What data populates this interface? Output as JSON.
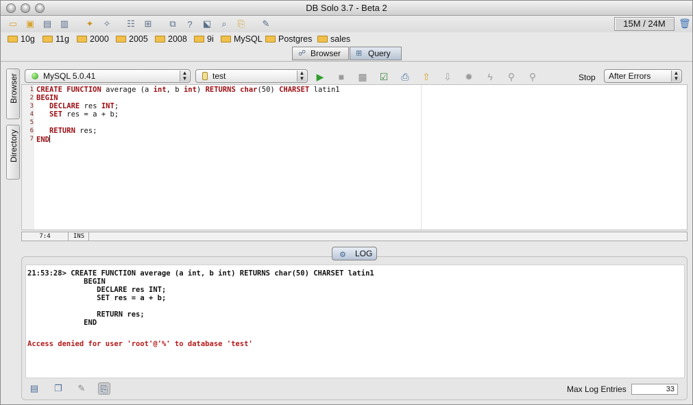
{
  "window": {
    "title": "DB Solo  3.7 - Beta 2"
  },
  "memory": {
    "label": "15M / 24M"
  },
  "bookmarks": [
    "10g",
    "11g",
    "2000",
    "2005",
    "2008",
    "9i",
    "MySQL",
    "Postgres",
    "sales"
  ],
  "tabs": {
    "browser": "Browser",
    "query": "Query"
  },
  "sidebar": {
    "browser": "Browser",
    "directory": "Directory"
  },
  "query_bar": {
    "server": "MySQL 5.0.41",
    "database": "test",
    "stop_label": "Stop",
    "stop_mode": "After Errors"
  },
  "editor": {
    "lines": [
      {
        "n": "1",
        "parts": [
          [
            "kw",
            "CREATE FUNCTION"
          ],
          [
            "t",
            " average (a "
          ],
          [
            "kw",
            "int"
          ],
          [
            "t",
            ", b "
          ],
          [
            "kw",
            "int"
          ],
          [
            "t",
            ") "
          ],
          [
            "kw",
            "RETURNS"
          ],
          [
            "t",
            " "
          ],
          [
            "kw",
            "char"
          ],
          [
            "t",
            "(50) "
          ],
          [
            "kw",
            "CHARSET"
          ],
          [
            "t",
            " latin1"
          ]
        ]
      },
      {
        "n": "2",
        "parts": [
          [
            "kw",
            "BEGIN"
          ]
        ]
      },
      {
        "n": "3",
        "parts": [
          [
            "t",
            "   "
          ],
          [
            "kw",
            "DECLARE"
          ],
          [
            "t",
            " res "
          ],
          [
            "kw",
            "INT"
          ],
          [
            "t",
            ";"
          ]
        ]
      },
      {
        "n": "4",
        "parts": [
          [
            "t",
            "   "
          ],
          [
            "kw",
            "SET"
          ],
          [
            "t",
            " res = a + b;"
          ]
        ]
      },
      {
        "n": "5",
        "parts": []
      },
      {
        "n": "6",
        "parts": [
          [
            "t",
            "   "
          ],
          [
            "kw",
            "RETURN"
          ],
          [
            "t",
            " res;"
          ]
        ]
      },
      {
        "n": "7",
        "parts": [
          [
            "kw",
            "END"
          ]
        ]
      }
    ]
  },
  "status": {
    "position": "7:4",
    "mode": "INS"
  },
  "log": {
    "button": "LOG",
    "lines": [
      "21:53:28> CREATE FUNCTION average (a int, b int) RETURNS char(50) CHARSET latin1",
      "             BEGIN",
      "                DECLARE res INT;",
      "                SET res = a + b;",
      "",
      "                RETURN res;",
      "             END"
    ],
    "error": "Access denied for user 'root'@'%' to database 'test'",
    "max_entries_label": "Max Log Entries",
    "max_entries": "33"
  }
}
